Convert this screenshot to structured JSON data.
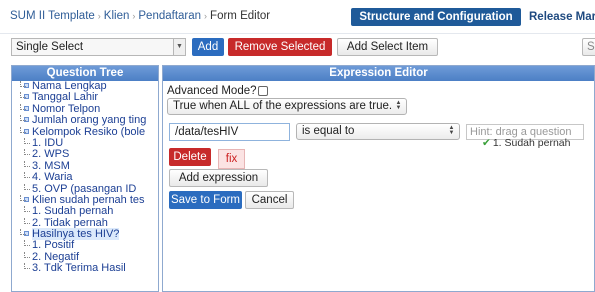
{
  "breadcrumb": {
    "items": [
      "SUM II Template",
      "Klien",
      "Pendaftaran"
    ],
    "current": "Form Editor",
    "separator": "›"
  },
  "topbar": {
    "structure_label": "Structure and Configuration",
    "release_label": "Release Mar"
  },
  "toolbar": {
    "type_select_value": "Single Select",
    "add_label": "Add",
    "remove_label": "Remove Selected",
    "add_select_item_label": "Add Select Item",
    "save_partial_label": "Sa"
  },
  "tree": {
    "header": "Question Tree",
    "items": [
      {
        "label": "Nama Lengkap",
        "level": 0
      },
      {
        "label": "Tanggal Lahir",
        "level": 0
      },
      {
        "label": "Nomor Telpon",
        "level": 0
      },
      {
        "label": "Jumlah orang yang ting",
        "level": 0
      },
      {
        "label": "Kelompok Resiko (bole",
        "level": 0
      },
      {
        "label": "1. IDU",
        "level": 1
      },
      {
        "label": "2. WPS",
        "level": 1
      },
      {
        "label": "3. MSM",
        "level": 1
      },
      {
        "label": "4. Waria",
        "level": 1
      },
      {
        "label": "5. OVP (pasangan ID",
        "level": 1
      },
      {
        "label": "Klien sudah pernah tes",
        "level": 0
      },
      {
        "label": "1. Sudah pernah",
        "level": 1
      },
      {
        "label": "2. Tidak pernah",
        "level": 1
      },
      {
        "label": "Hasilnya tes HIV?",
        "level": 0,
        "selected": true
      },
      {
        "label": "1. Positif",
        "level": 1
      },
      {
        "label": "2. Negatif",
        "level": 1
      },
      {
        "label": "3. Tdk Terima Hasil",
        "level": 1
      }
    ]
  },
  "editor": {
    "header": "Expression Editor",
    "advanced_mode_label": "Advanced Mode?",
    "logic_value": "True when ALL of the expressions are true.",
    "path_value": "/data/tesHIV",
    "operator_value": "is equal to",
    "value_hint": "Hint: drag a question",
    "selected_value": "1. Sudah pernah",
    "delete_label": "Delete",
    "fix_label": "fix",
    "add_expression_label": "Add expression",
    "save_form_label": "Save to Form",
    "cancel_label": "Cancel"
  },
  "colors": {
    "primary": "#2b6cbf",
    "danger": "#c72a2a",
    "header": "#5a89cc",
    "link": "#2f5d97"
  }
}
